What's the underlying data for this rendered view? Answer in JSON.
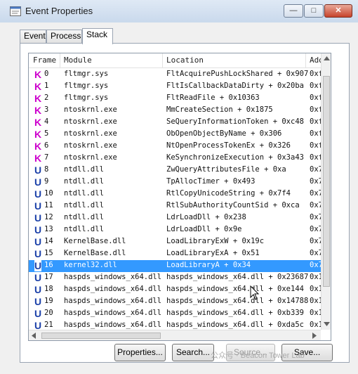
{
  "window": {
    "title": "Event Properties"
  },
  "title_controls": {
    "minimize": "—",
    "maximize": "□",
    "close": "✕"
  },
  "tabs": [
    {
      "label": "Event"
    },
    {
      "label": "Process"
    },
    {
      "label": "Stack"
    }
  ],
  "active_tab": "Stack",
  "columns": [
    "Frame",
    "Module",
    "Location",
    "Add"
  ],
  "rows": [
    {
      "type": "K",
      "frame": "0",
      "module": "fltmgr.sys",
      "location": "FltAcquirePushLockShared + 0x907",
      "addr": "0xf"
    },
    {
      "type": "K",
      "frame": "1",
      "module": "fltmgr.sys",
      "location": "FltIsCallbackDataDirty + 0x20ba",
      "addr": "0xf"
    },
    {
      "type": "K",
      "frame": "2",
      "module": "fltmgr.sys",
      "location": "FltReadFile + 0x10363",
      "addr": "0xf"
    },
    {
      "type": "K",
      "frame": "3",
      "module": "ntoskrnl.exe",
      "location": "MmCreateSection + 0x1875",
      "addr": "0xf"
    },
    {
      "type": "K",
      "frame": "4",
      "module": "ntoskrnl.exe",
      "location": "SeQueryInformationToken + 0xc48",
      "addr": "0xf"
    },
    {
      "type": "K",
      "frame": "5",
      "module": "ntoskrnl.exe",
      "location": "ObOpenObjectByName + 0x306",
      "addr": "0xf"
    },
    {
      "type": "K",
      "frame": "6",
      "module": "ntoskrnl.exe",
      "location": "NtOpenProcessTokenEx + 0x326",
      "addr": "0xf"
    },
    {
      "type": "K",
      "frame": "7",
      "module": "ntoskrnl.exe",
      "location": "KeSynchronizeExecution + 0x3a43",
      "addr": "0xf"
    },
    {
      "type": "U",
      "frame": "8",
      "module": "ntdll.dll",
      "location": "ZwQueryAttributesFile + 0xa",
      "addr": "0x7"
    },
    {
      "type": "U",
      "frame": "9",
      "module": "ntdll.dll",
      "location": "TpAllocTimer + 0x493",
      "addr": "0x7"
    },
    {
      "type": "U",
      "frame": "10",
      "module": "ntdll.dll",
      "location": "RtlCopyUnicodeString + 0x7f4",
      "addr": "0x7"
    },
    {
      "type": "U",
      "frame": "11",
      "module": "ntdll.dll",
      "location": "RtlSubAuthorityCountSid + 0xca",
      "addr": "0x7"
    },
    {
      "type": "U",
      "frame": "12",
      "module": "ntdll.dll",
      "location": "LdrLoadDll + 0x238",
      "addr": "0x7"
    },
    {
      "type": "U",
      "frame": "13",
      "module": "ntdll.dll",
      "location": "LdrLoadDll + 0x9e",
      "addr": "0x7"
    },
    {
      "type": "U",
      "frame": "14",
      "module": "KernelBase.dll",
      "location": "LoadLibraryExW + 0x19c",
      "addr": "0x7"
    },
    {
      "type": "U",
      "frame": "15",
      "module": "KernelBase.dll",
      "location": "LoadLibraryExA + 0x51",
      "addr": "0x7"
    },
    {
      "type": "U",
      "frame": "16",
      "module": "kernel32.dll",
      "location": "LoadLibraryA + 0x34",
      "addr": "0x7",
      "selected": true
    },
    {
      "type": "U",
      "frame": "17",
      "module": "haspds_windows_x64.dll",
      "location": "haspds_windows_x64.dll + 0x23687",
      "addr": "0x1"
    },
    {
      "type": "U",
      "frame": "18",
      "module": "haspds_windows_x64.dll",
      "location": "haspds_windows_x64.dll + 0xe144",
      "addr": "0x1"
    },
    {
      "type": "U",
      "frame": "19",
      "module": "haspds_windows_x64.dll",
      "location": "haspds_windows_x64.dll + 0x14788",
      "addr": "0x1"
    },
    {
      "type": "U",
      "frame": "20",
      "module": "haspds_windows_x64.dll",
      "location": "haspds_windows_x64.dll + 0xb339",
      "addr": "0x1"
    },
    {
      "type": "U",
      "frame": "21",
      "module": "haspds_windows_x64.dll",
      "location": "haspds_windows_x64.dll + 0xda5c",
      "addr": "0x1"
    }
  ],
  "buttons": {
    "properties": "Properties...",
    "search": "Search...",
    "source": "Source...",
    "save": "Save..."
  },
  "watermark": "公众号 · Beacon Tower Lab",
  "icons": {
    "title": "window-properties-icon",
    "kernel_frame": "K",
    "user_frame": "U"
  },
  "colors": {
    "kernel_badge": "#cc00cc",
    "user_badge": "#1a3fa8",
    "selection": "#3399ff"
  }
}
